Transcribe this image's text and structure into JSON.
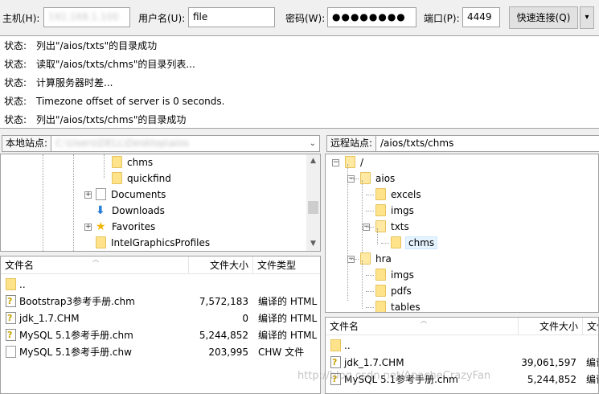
{
  "quickconnect": {
    "host_label": "主机(H):",
    "host_value": "192.168.1.100",
    "user_label": "用户名(U):",
    "user_value": "file",
    "pass_label": "密码(W):",
    "pass_value": "●●●●●●●●",
    "port_label": "端口(P):",
    "port_value": "4449",
    "connect_label": "快速连接(Q)",
    "dropdown_glyph": "▾"
  },
  "log": [
    {
      "status": "状态:",
      "text": "列出\"/aios/txts\"的目录成功"
    },
    {
      "status": "状态:",
      "text": "读取\"/aios/txts/chms\"的目录列表..."
    },
    {
      "status": "状态:",
      "text": "计算服务器时差..."
    },
    {
      "status": "状态:",
      "text": "Timezone offset of server is 0 seconds."
    },
    {
      "status": "状态:",
      "text": "列出\"/aios/txts/chms\"的目录成功"
    }
  ],
  "local": {
    "label": "本地站点:",
    "path": "C:\\Users\\DELL\\Desktop\\aios",
    "tree": [
      {
        "name": "chms",
        "type": "folder"
      },
      {
        "name": "quickfind",
        "type": "folder"
      },
      {
        "name": "Documents",
        "type": "documents"
      },
      {
        "name": "Downloads",
        "type": "downloads"
      },
      {
        "name": "Favorites",
        "type": "favorites"
      },
      {
        "name": "IntelGraphicsProfiles",
        "type": "folder"
      }
    ],
    "columns": {
      "name": "文件名",
      "size": "文件大小",
      "type": "文件类型"
    },
    "files": [
      {
        "name": "..",
        "size": "",
        "type": "",
        "icon": "fold"
      },
      {
        "name": "Bootstrap3参考手册.chm",
        "size": "7,572,183",
        "type": "编译的 HTML",
        "icon": "chm"
      },
      {
        "name": "jdk_1.7.CHM",
        "size": "0",
        "type": "编译的 HTML",
        "icon": "chm"
      },
      {
        "name": "MySQL 5.1参考手册.chm",
        "size": "5,244,852",
        "type": "编译的 HTML",
        "icon": "chm"
      },
      {
        "name": "MySQL 5.1参考手册.chw",
        "size": "203,995",
        "type": "CHW 文件",
        "icon": "doc"
      }
    ]
  },
  "remote": {
    "label": "远程站点:",
    "path": "/aios/txts/chms",
    "tree": [
      {
        "name": "/",
        "level": 0,
        "toggle": "−"
      },
      {
        "name": "aios",
        "level": 1,
        "toggle": "−"
      },
      {
        "name": "excels",
        "level": 2,
        "toggle": ""
      },
      {
        "name": "imgs",
        "level": 2,
        "toggle": ""
      },
      {
        "name": "txts",
        "level": 2,
        "toggle": "−"
      },
      {
        "name": "chms",
        "level": 3,
        "toggle": "",
        "selected": true
      },
      {
        "name": "hra",
        "level": 1,
        "toggle": "−"
      },
      {
        "name": "imgs",
        "level": 2,
        "toggle": ""
      },
      {
        "name": "pdfs",
        "level": 2,
        "toggle": ""
      },
      {
        "name": "tables",
        "level": 2,
        "toggle": ""
      }
    ],
    "columns": {
      "name": "文件名",
      "size": "文件大小",
      "type": "文件"
    },
    "files": [
      {
        "name": "..",
        "size": "",
        "type": "",
        "icon": "fold"
      },
      {
        "name": "jdk_1.7.CHM",
        "size": "39,061,597",
        "type": "编译",
        "icon": "chm"
      },
      {
        "name": "MySQL 5.1参考手册.chm",
        "size": "5,244,852",
        "type": "编译",
        "icon": "chm"
      }
    ]
  },
  "watermark": "http://blog.csdn.net/ApacheCrazyFan"
}
